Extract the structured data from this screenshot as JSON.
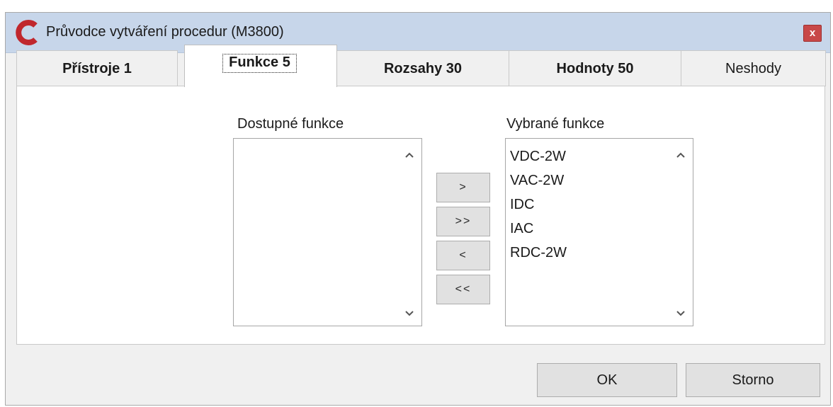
{
  "window": {
    "title": "Průvodce vytváření procedur (M3800)",
    "close_label": "x",
    "logo_color": "#c0272d"
  },
  "tabs": [
    {
      "label": "Přístroje 1",
      "active": false
    },
    {
      "label": "Funkce 5",
      "active": true
    },
    {
      "label": "Rozsahy 30",
      "active": false
    },
    {
      "label": "Hodnoty 50",
      "active": false
    },
    {
      "label": "Neshody",
      "active": false
    }
  ],
  "available": {
    "label": "Dostupné funkce",
    "items": []
  },
  "selected": {
    "label": "Vybrané funkce",
    "items": [
      "VDC-2W",
      "VAC-2W",
      "IDC",
      "IAC",
      "RDC-2W"
    ]
  },
  "move_buttons": {
    "add": ">",
    "add_all": ">>",
    "remove": "<",
    "remove_all": "<<"
  },
  "footer": {
    "ok_label": "OK",
    "cancel_label": "Storno"
  }
}
